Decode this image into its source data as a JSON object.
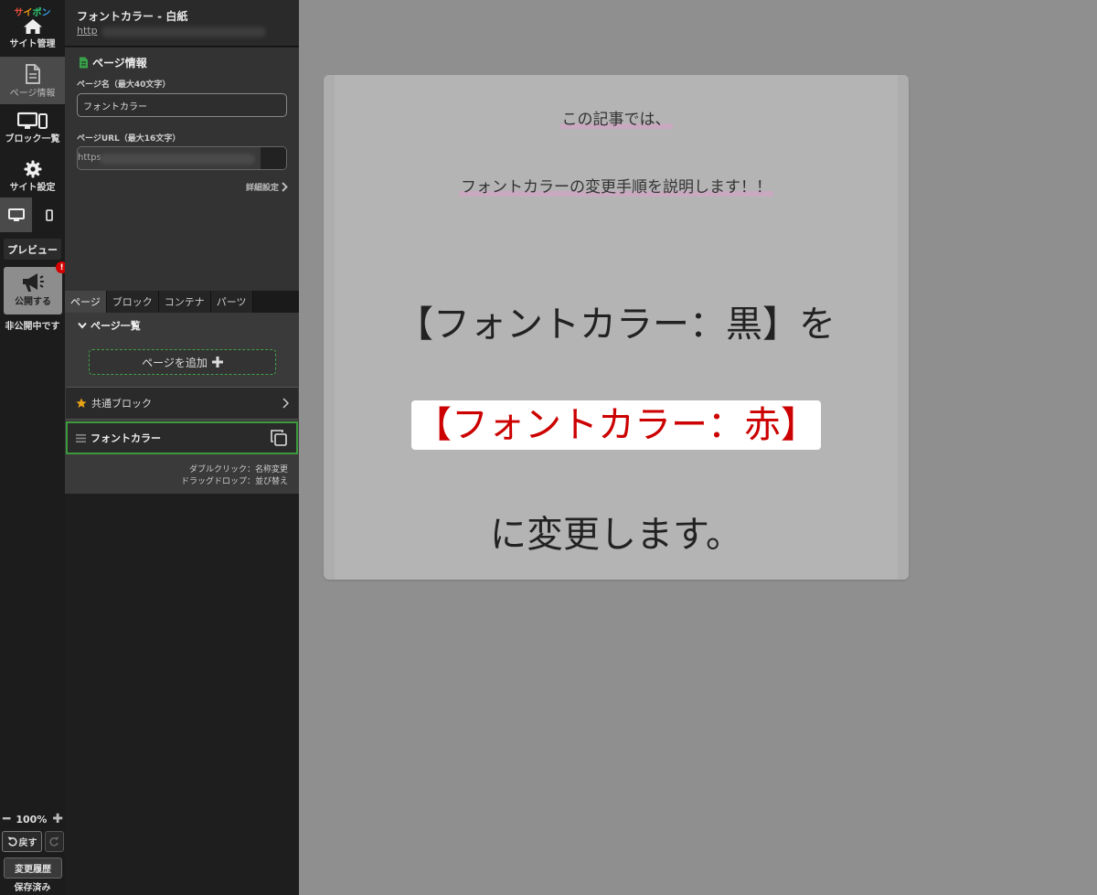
{
  "sidebar": {
    "logo": [
      "サ",
      "イ",
      "ポ",
      "ン"
    ],
    "items": [
      {
        "label": "サイト管理",
        "icon": "home-icon"
      },
      {
        "label": "ページ情報",
        "icon": "document-icon"
      },
      {
        "label": "ブロック一覧",
        "icon": "devices-icon"
      },
      {
        "label": "サイト設定",
        "icon": "gear-icon"
      }
    ],
    "preview_label": "プレビュー",
    "publish_label": "公開する",
    "alert_badge": "!",
    "status": "非公開中です",
    "zoom": "100%",
    "undo_label": "戻す",
    "history_label": "変更履歴",
    "saved_label": "保存済み"
  },
  "panel": {
    "page_title": "フォントカラー - 白紙",
    "page_url": "http",
    "section_title": "ページ情報",
    "page_name_label": "ページ名（最大40文字）",
    "page_name_value": "フォントカラー",
    "page_url_label": "ページURL（最大16文字）",
    "page_url_value": "https",
    "detail_link": "詳細設定",
    "tabs": [
      "ページ",
      "ブロック",
      "コンテナ",
      "パーツ"
    ],
    "page_list_title": "ページ一覧",
    "add_page_label": "ページを追加",
    "common_block_label": "共通ブロック",
    "current_page_label": "フォントカラー",
    "hint_dblclick": "ダブルクリック：名称変更",
    "hint_drag": "ドラッグドロップ：並び替え"
  },
  "canvas": {
    "line1": "この記事では、",
    "line2": "フォントカラーの変更手順を説明します！！",
    "line3": "【フォントカラー：黒】を",
    "line4": "【フォントカラー：赤】",
    "line5": "に変更します。"
  },
  "colors": {
    "accent_green": "#3c9a3c",
    "red_text": "#cc0000",
    "alert": "#d40000"
  }
}
